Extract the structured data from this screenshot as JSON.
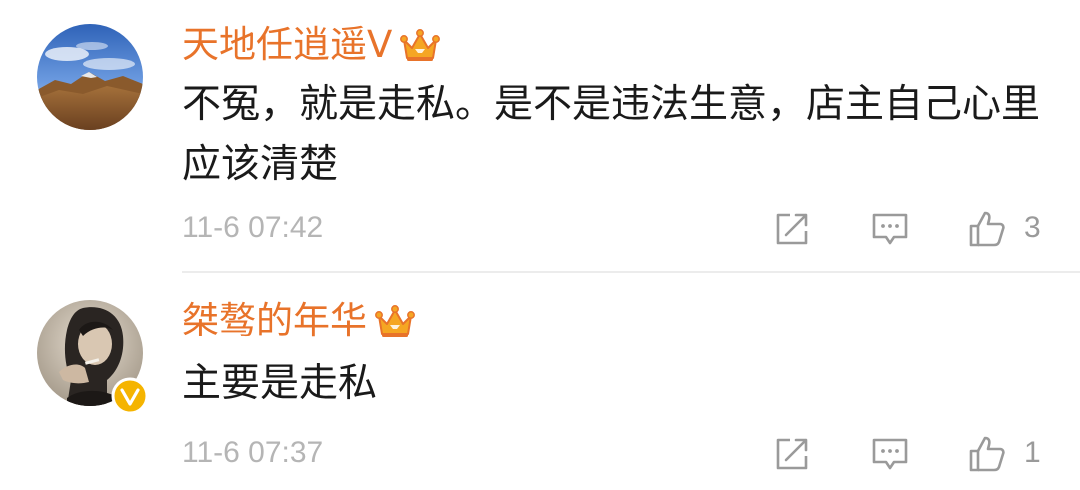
{
  "comments": [
    {
      "username": "天地任逍遥V",
      "text": "不冤，就是走私。是不是违法生意，店主自己心里应该清楚",
      "timestamp": "11-6 07:42",
      "like_count": "3",
      "avatar": "landscape-mountain-avatar",
      "vip_icon": "crown-icon"
    },
    {
      "username": "桀骜的年华",
      "text": "主要是走私",
      "timestamp": "11-6 07:37",
      "like_count": "1",
      "avatar": "person-portrait-avatar",
      "vip_icon": "crown-icon",
      "verified_icon": "verified-badge-icon"
    }
  ],
  "colors": {
    "username": "#e8732a",
    "text": "#1a1a1a",
    "timestamp": "#b5b5b5",
    "icon": "#9a9a9a",
    "crown": "#f5a623",
    "verified": "#f5b400",
    "divider": "#ececec"
  },
  "icons": {
    "share": "share-icon",
    "reply": "comment-icon",
    "like": "thumbs-up-icon"
  }
}
